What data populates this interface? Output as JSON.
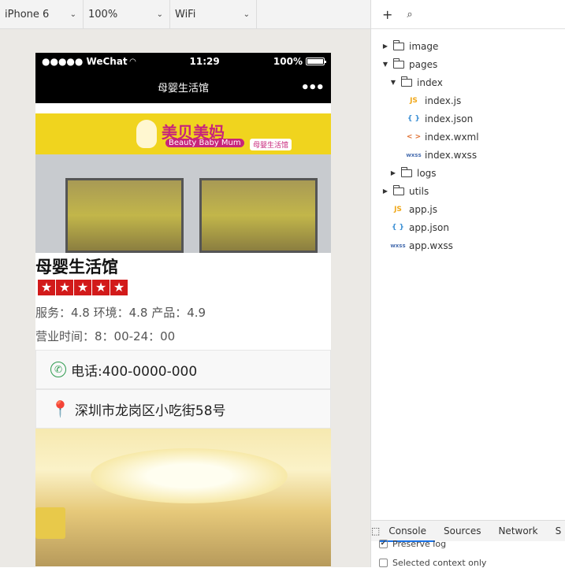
{
  "toolbar": {
    "device": "iPhone 6",
    "zoom": "100%",
    "network": "WiFi"
  },
  "phone": {
    "status": {
      "carrier": "●●●●● WeChat",
      "time": "11:29",
      "battery": "100%"
    },
    "nav_title": "母婴生活馆",
    "nav_more": "•••",
    "hero": {
      "brand": "美贝美妈",
      "brand_sub": "Beauty Baby Mum",
      "store_tag": "母婴生活馆"
    },
    "shop": {
      "name": "母婴生活馆",
      "stars": [
        "★",
        "★",
        "★",
        "★",
        "★"
      ],
      "ratings": "服务：4.8 环境：4.8 产品：4.9",
      "hours": "营业时间：8：00-24：00",
      "phone": "电话:400-0000-000",
      "address": "深圳市龙岗区小吃街58号"
    }
  },
  "file_tree": [
    {
      "label": "image",
      "type": "folder",
      "expanded": false
    },
    {
      "label": "pages",
      "type": "folder",
      "expanded": true
    },
    {
      "label": "index",
      "type": "folder",
      "expanded": true
    },
    {
      "label": "index.js",
      "type": "js"
    },
    {
      "label": "index.json",
      "type": "json"
    },
    {
      "label": "index.wxml",
      "type": "wxml"
    },
    {
      "label": "index.wxss",
      "type": "wxss"
    },
    {
      "label": "logs",
      "type": "folder",
      "expanded": false
    },
    {
      "label": "utils",
      "type": "folder",
      "expanded": false
    },
    {
      "label": "app.js",
      "type": "js"
    },
    {
      "label": "app.json",
      "type": "json"
    },
    {
      "label": "app.wxss",
      "type": "wxss"
    }
  ],
  "icons": {
    "js": "JS",
    "json": "{ }",
    "wxml": "< >",
    "wxss": "wxss"
  },
  "devtools": {
    "tabs": [
      "Console",
      "Sources",
      "Network",
      "S"
    ],
    "active_tab": "Console",
    "options": [
      {
        "label": "Preserve log",
        "checked": true
      },
      {
        "label": "Selected context only",
        "checked": false
      }
    ]
  },
  "colors": {
    "star_red": "#d21a1a",
    "brand_pink": "#c8247a",
    "phone_green": "#2d9a4e",
    "pin_magenta": "#d11a57"
  }
}
